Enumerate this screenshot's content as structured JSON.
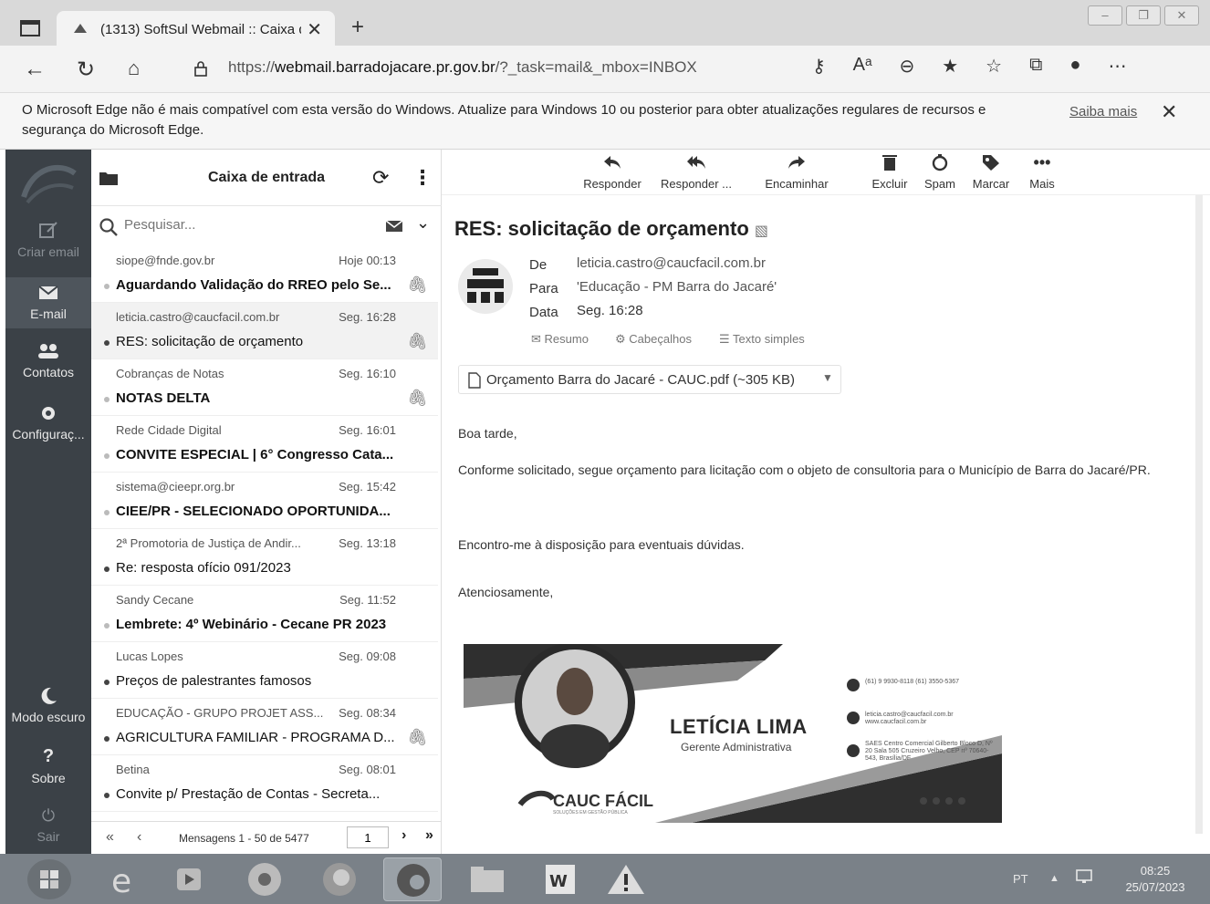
{
  "browser": {
    "tab_title": "(1313) SoftSul Webmail :: Caixa d",
    "new_tab_label": "+",
    "close_tab_label": "✕",
    "url_prefix": "https://",
    "url_domain": "webmail.barradojacare.pr.gov.br",
    "url_path": "/?_task=mail&_mbox=INBOX"
  },
  "infobar": {
    "message": "O Microsoft Edge não é mais compatível com esta versão do Windows. Atualize para Windows 10 ou posterior para obter atualizações regulares de recursos e segurança do Microsoft Edge.",
    "link": "Saiba mais",
    "close_label": "✕"
  },
  "nav": {
    "items": [
      {
        "label": "Criar email",
        "icon": "compose-icon"
      },
      {
        "label": "E-mail",
        "icon": "envelope-icon"
      },
      {
        "label": "Contatos",
        "icon": "contacts-icon"
      },
      {
        "label": "Configuraç...",
        "icon": "gear-icon"
      }
    ],
    "dark_mode": "Modo escuro",
    "help": "Sobre",
    "logout": "Sair"
  },
  "mailbox": {
    "title": "Caixa de entrada",
    "search_placeholder": "Pesquisar...",
    "messages": [
      {
        "from": "siope@fnde.gov.br",
        "date": "Hoje 00:13",
        "subject": "Aguardando Validação do RREO pelo Se...",
        "bold": true,
        "attachment": true
      },
      {
        "from": "leticia.castro@caucfacil.com.br",
        "date": "Seg. 16:28",
        "subject": "RES: solicitação de orçamento",
        "bold": false,
        "attachment": true
      },
      {
        "from": "Cobranças de Notas",
        "date": "Seg. 16:10",
        "subject": "NOTAS DELTA",
        "bold": true,
        "attachment": true
      },
      {
        "from": "Rede Cidade Digital",
        "date": "Seg. 16:01",
        "subject": "CONVITE ESPECIAL | 6° Congresso Cata...",
        "bold": true,
        "attachment": false
      },
      {
        "from": "sistema@cieepr.org.br",
        "date": "Seg. 15:42",
        "subject": "CIEE/PR - SELECIONADO OPORTUNIDA...",
        "bold": true,
        "attachment": false
      },
      {
        "from": "2ª Promotoria de Justiça de Andir...",
        "date": "Seg. 13:18",
        "subject": "Re: resposta ofício 091/2023",
        "bold": false,
        "attachment": false
      },
      {
        "from": "Sandy Cecane",
        "date": "Seg. 11:52",
        "subject": "Lembrete: 4º Webinário - Cecane PR 2023",
        "bold": true,
        "attachment": false
      },
      {
        "from": "Lucas Lopes",
        "date": "Seg. 09:08",
        "subject": "Preços de palestrantes famosos",
        "bold": false,
        "attachment": false
      },
      {
        "from": "EDUCAÇÃO - GRUPO PROJET ASS...",
        "date": "Seg. 08:34",
        "subject": "AGRICULTURA FAMILIAR - PROGRAMA D...",
        "bold": false,
        "attachment": true
      },
      {
        "from": "Betina",
        "date": "Seg. 08:01",
        "subject": "Convite p/ Prestação de Contas - Secreta...",
        "bold": false,
        "attachment": false
      }
    ],
    "pagination": {
      "first": "«",
      "prev": "‹",
      "label": "Mensagens 1 - 50 de 5477",
      "page": "1",
      "next": "›",
      "last": "»"
    }
  },
  "toolbar": {
    "reply": "Responder",
    "reply_all": "Responder ...",
    "forward": "Encaminhar",
    "delete": "Excluir",
    "spam": "Spam",
    "mark": "Marcar",
    "more": "Mais"
  },
  "message": {
    "subject": "RES: solicitação de orçamento",
    "from_label": "De",
    "from": "leticia.castro@caucfacil.com.br",
    "to_label": "Para",
    "to": "'Educação - PM Barra do Jacaré'",
    "date_label": "Data",
    "date": "Seg. 16:28",
    "options": [
      "Resumo",
      "Cabeçalhos",
      "Texto simples"
    ],
    "attachment": "Orçamento Barra do Jacaré - CAUC.pdf (~305 KB)",
    "body": [
      "Boa tarde,",
      "Conforme solicitado, segue orçamento para licitação com o objeto de consultoria para o Município de Barra do Jacaré/PR.",
      "Encontro-me à disposição para eventuais dúvidas.",
      "Atenciosamente,"
    ],
    "signature": {
      "name": "LETÍCIA LIMA",
      "role": "Gerente Administrativa",
      "brand": "CAUC FÁCIL",
      "tagline": "SOLUÇÕES EM GESTÃO PÚBLICA",
      "phone": "(61) 9 9930-8118 (61) 3550-5367",
      "email": "leticia.castro@caucfacil.com.br www.caucfacil.com.br",
      "address": "SAES Centro Comercial Gilberto Bloco D, Nº 20 Sala 505 Cruzeiro Velho, CEP nº 70640-543, Brasília/DF"
    }
  },
  "taskbar": {
    "lang": "PT",
    "tray_arrow": "▲",
    "time": "08:25",
    "date": "25/07/2023"
  },
  "colors": {
    "sidebar": "#3b4147",
    "taskbar": "#7a8188",
    "tabbar": "#d9d9d9"
  }
}
